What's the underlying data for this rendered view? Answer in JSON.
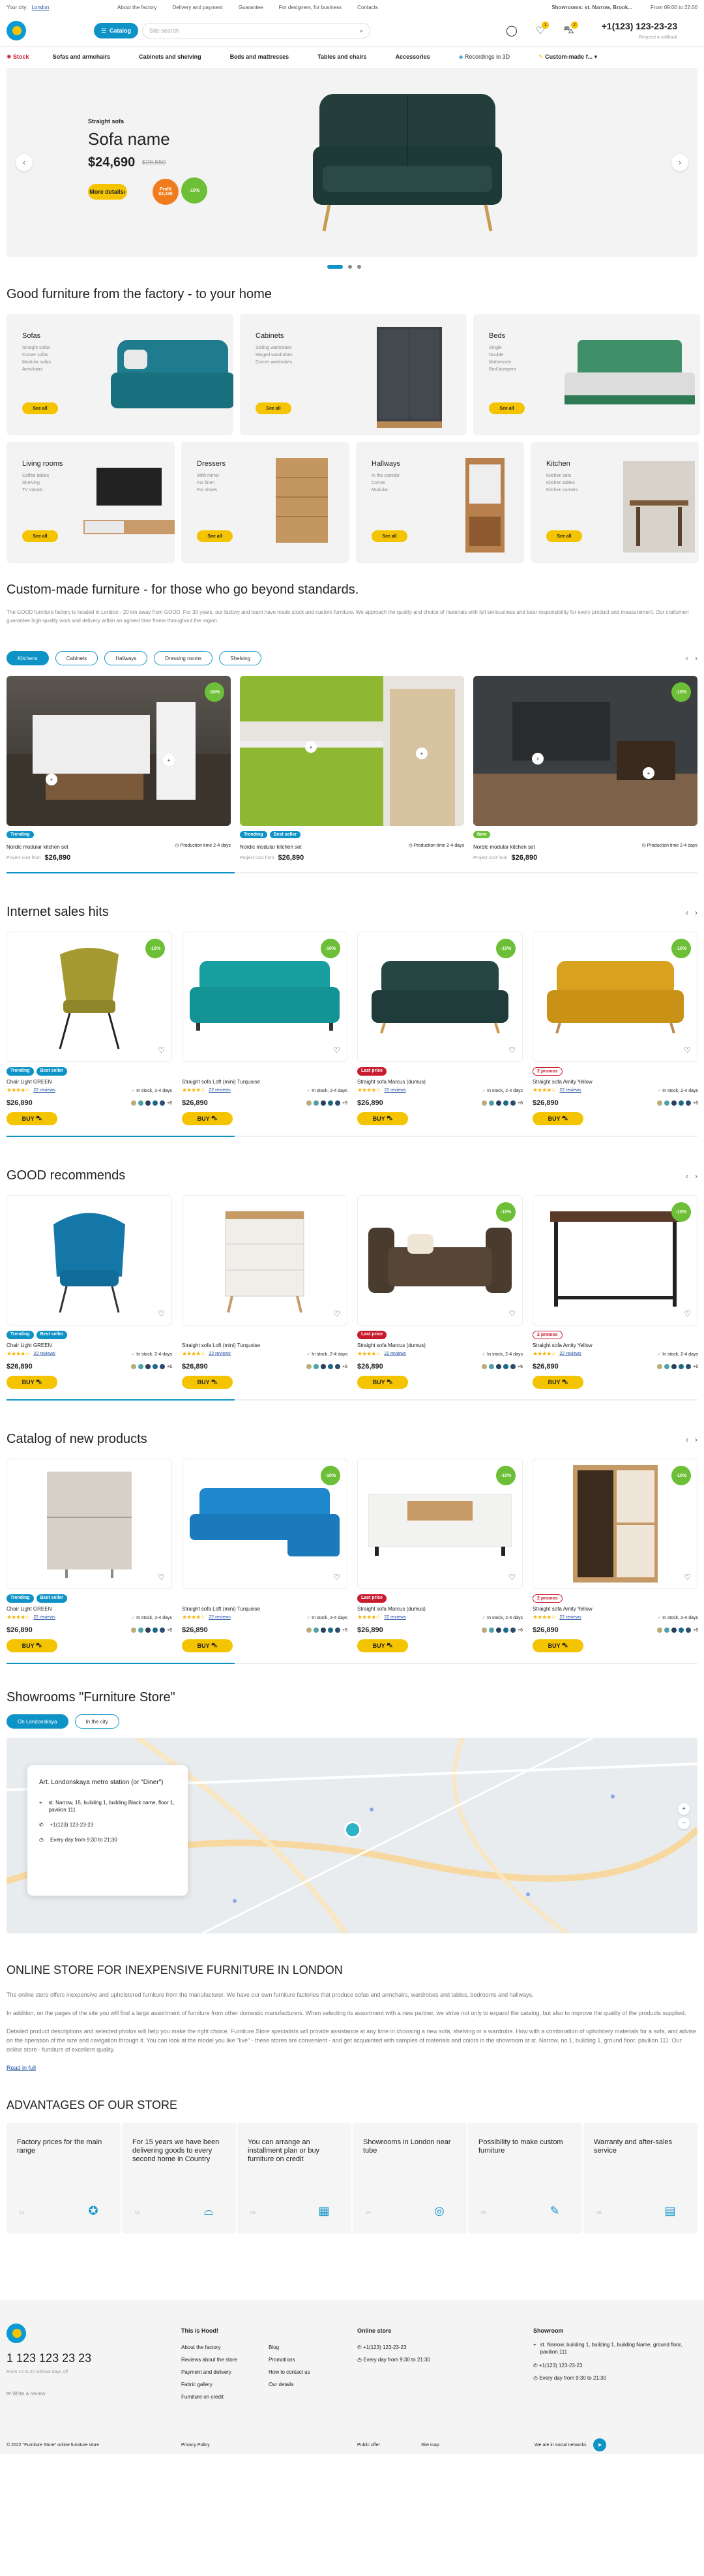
{
  "topbar": {
    "city_label": "Your city:",
    "city": "London",
    "links": [
      "About the factory",
      "Delivery and payment",
      "Guarantee",
      "For designers, for business",
      "Contacts"
    ],
    "showrooms": "Showrooms: st. Narrow, Brook...",
    "hours": "From 09:00 to 22:00"
  },
  "header": {
    "catalog": "Catalog",
    "search_placeholder": "Site search",
    "phone": "+1(123) 123-23-23",
    "callback": "Request a callback",
    "cart_count": "2",
    "fav_count": "1"
  },
  "nav": {
    "stock": "Stock",
    "items": [
      "Sofas and armchairs",
      "Cabinets and shelving",
      "Beds and mattresses",
      "Tables and chairs",
      "Accessories"
    ],
    "recordings": "Recordings in 3D",
    "custom": "Custom-made f..."
  },
  "hero": {
    "small": "Straight sofa",
    "title": "Sofa name",
    "price": "$24,690",
    "old_price": "$28,550",
    "more": "More details",
    "badge1": "Profit $3,150",
    "badge2": "-10%"
  },
  "categories": {
    "title": "Good furniture from the factory - to your home",
    "see_all": "See all",
    "items": [
      {
        "name": "Sofas",
        "subs": [
          "Straight sofas",
          "Corner sofas",
          "Modular sofas",
          "Armchairs"
        ]
      },
      {
        "name": "Cabinets",
        "subs": [
          "Sliding wardrobes",
          "Hinged wardrobes",
          "Corner wardrobes"
        ]
      },
      {
        "name": "Beds",
        "subs": [
          "Single",
          "Double",
          "Mattresses",
          "Bed bumpers"
        ]
      },
      {
        "name": "Living rooms",
        "subs": [
          "Coffee tables",
          "Shelving",
          "TV stands"
        ]
      },
      {
        "name": "Dressers",
        "subs": [
          "With mirror",
          "For linen",
          "For shoes"
        ]
      },
      {
        "name": "Hallways",
        "subs": [
          "In the corridor",
          "Corner",
          "Modular"
        ]
      },
      {
        "name": "Kitchen",
        "subs": [
          "Kitchen sets",
          "Kitchen tables",
          "Kitchen corners"
        ]
      }
    ]
  },
  "custom": {
    "title": "Custom-made furniture - for those who go beyond standards.",
    "text": "The GOOD furniture factory is located in London - 20 km away from GOOD. For 30 years, our factory and team have made stock and custom furniture. We approach the quality and choice of materials with full seriousness and bear responsibility for every product and measurement. Our craftsmen guarantee high-quality work and delivery within an agreed time frame throughout the region.",
    "tabs": [
      "Kitchens",
      "Cabinets",
      "Hallways",
      "Dressing rooms",
      "Shelving"
    ],
    "items": [
      {
        "badges": [
          "Trending"
        ],
        "name": "Nordic modular kitchen set",
        "prod": "Production time 2-4 days",
        "from": "Project cost from",
        "price": "$26,890"
      },
      {
        "badges": [
          "Trending",
          "Best seller"
        ],
        "name": "Nordic modular kitchen set",
        "prod": "Production time 2-4 days",
        "from": "Project cost from",
        "price": "$26,890"
      },
      {
        "badges": [
          "New"
        ],
        "name": "Nordic modular kitchen set",
        "prod": "Production time 2-4 days",
        "from": "Project cost from",
        "price": "$26,890"
      }
    ]
  },
  "sections": [
    {
      "title": "Internet sales hits",
      "items": [
        {
          "badges": [
            "Trending",
            "Best seller"
          ],
          "name": "Chair Light GREEN",
          "stock": "In stock, 2-4 days",
          "price": "$26,890",
          "pct": "-10%",
          "reviews": "22 reviews",
          "more": "+6"
        },
        {
          "badges": [],
          "name": "Straight sofa Loft (mini) Turquoise",
          "stock": "In stock, 2-4 days",
          "price": "$26,890",
          "pct": "-10%",
          "reviews": "22 reviews",
          "more": "+6"
        },
        {
          "badges": [
            "Last price"
          ],
          "name": "Straight sofa Marcus (dumus)",
          "stock": "In stock, 2-4 days",
          "price": "$26,890",
          "pct": "-10%",
          "reviews": "22 reviews",
          "more": "+6"
        },
        {
          "badges": [
            "2 promos"
          ],
          "name": "Straight sofa Amity Yellow",
          "stock": "In stock, 2-4 days",
          "price": "$26,890",
          "pct": "-10%",
          "reviews": "22 reviews",
          "more": "+6"
        }
      ]
    },
    {
      "title": "GOOD recommends",
      "items": [
        {
          "badges": [
            "Trending",
            "Best seller"
          ],
          "name": "Chair Light GREEN",
          "stock": "In stock, 2-4 days",
          "price": "$26,890",
          "pct": "",
          "reviews": "22 reviews",
          "more": "+6"
        },
        {
          "badges": [],
          "name": "Straight sofa Loft (mini) Turquoise",
          "stock": "In stock, 2-4 days",
          "price": "$26,890",
          "pct": "",
          "reviews": "22 reviews",
          "more": "+6"
        },
        {
          "badges": [
            "Last price"
          ],
          "name": "Straight sofa Marcus (dumus)",
          "stock": "In stock, 2-4 days",
          "price": "$26,890",
          "pct": "-10%",
          "reviews": "22 reviews",
          "more": "+6"
        },
        {
          "badges": [
            "2 promos"
          ],
          "name": "Straight sofa Amity Yellow",
          "stock": "In stock, 2-4 days",
          "price": "$26,890",
          "pct": "-10%",
          "reviews": "22 reviews",
          "more": "+6"
        }
      ]
    },
    {
      "title": "Catalog of new products",
      "items": [
        {
          "badges": [
            "Trending",
            "Best seller"
          ],
          "name": "Chair Light GREEN",
          "stock": "In stock, 2-4 days",
          "price": "$26,890",
          "pct": "",
          "reviews": "22 reviews",
          "more": "+6"
        },
        {
          "badges": [],
          "name": "Straight sofa Loft (mini) Turquoise",
          "stock": "In stock, 2-4 days",
          "price": "$26,890",
          "pct": "-10%",
          "reviews": "22 reviews",
          "more": "+6"
        },
        {
          "badges": [
            "Last price"
          ],
          "name": "Straight sofa Marcus (dumus)",
          "stock": "In stock, 2-4 days",
          "price": "$26,890",
          "pct": "-10%",
          "reviews": "22 reviews",
          "more": "+6"
        },
        {
          "badges": [
            "2 promos"
          ],
          "name": "Straight sofa Amity Yellow",
          "stock": "In stock, 2-4 days",
          "price": "$26,890",
          "pct": "-10%",
          "reviews": "22 reviews",
          "more": "+6"
        }
      ]
    }
  ],
  "buy": "BUY",
  "showrooms": {
    "title": "Showrooms \"Furniture Store\"",
    "tabs": [
      "On Londonskaya",
      "In the city"
    ],
    "card_title": "Art. Londonskaya metro station (or \"Diner\")",
    "address": "st. Narrow, 15, building 1, building Black name, floor 1, pavilion 111",
    "phone": "+1(123) 123-23-23",
    "hours": "Every day from 9:30 to 21:30"
  },
  "seo": {
    "title": "ONLINE STORE FOR INEXPENSIVE FURNITURE IN LONDON",
    "p1": "The online store offers inexpensive and upholstered furniture from the manufacturer. We have our own furniture factories that produce sofas and armchairs, wardrobes and tables, bedrooms and hallways.",
    "p2": "In addition, on the pages of the site you will find a large assortment of furniture from other domestic manufacturers. When selecting its assortment with a new partner, we strive not only to expand the catalog, but also to improve the quality of the products supplied.",
    "p3": "Detailed product descriptions and selected photos will help you make the right choice. Furniture Store specialists will provide assistance at any time in choosing a new sofa, shelving or a wardrobe. How with a combination of upholstery materials for a sofa, and advise on the operation of the size and navigation through it. You can look at the model you like \"live\" - these stores are convenient - and get acquainted with samples of materials and colors in the showroom at st. Narrow, no 1, building 1, ground floor, pavilion 111. Our online store - furniture of excellent quality.",
    "more": "Read in full"
  },
  "advantages": {
    "title": "ADVANTAGES OF OUR STORE",
    "items": [
      {
        "text": "Factory prices for the main range",
        "num": "01"
      },
      {
        "text": "For 15 years we have been delivering goods to every second home in Country",
        "num": "02"
      },
      {
        "text": "You can arrange an installment plan or buy furniture on credit",
        "num": "03"
      },
      {
        "text": "Showrooms in London near tube",
        "num": "04"
      },
      {
        "text": "Possibility to make custom furniture",
        "num": "05"
      },
      {
        "text": "Warranty and after-sales service",
        "num": "06"
      }
    ]
  },
  "footer": {
    "phone": "1 123 123 23 23",
    "phone_note": "From 10 to 22 without days off",
    "review": "Write a review",
    "col1_title": "This is Hood!",
    "col1": [
      "About the factory",
      "Reviews about the store",
      "Payment and delivery",
      "Fabric gallery",
      "Furniture on credit"
    ],
    "col2": [
      "Blog",
      "Promotions",
      "How to contact us",
      "Our details"
    ],
    "store_title": "Online store",
    "store_phone": "+1(123) 123-23-23",
    "store_hours": "Every day from 9:30 to 21:30",
    "showroom_title": "Showroom",
    "showroom_addr": "st. Narrow, building 1, building 1, building Name, ground floor, pavilion 111",
    "showroom_phone": "+1(123) 123-23-23",
    "showroom_hours": "Every day from 9:30 to 21:30",
    "copyright": "© 2022 \"Furniture Store\" online furniture store",
    "privacy": "Privacy Policy",
    "offer": "Public offer",
    "sitemap": "Site map",
    "social": "We are in social networks"
  },
  "colors": {
    "accent": "#0e93c7",
    "yellow": "#f5c400",
    "red": "#c81b2d",
    "green": "#6cbf36"
  }
}
